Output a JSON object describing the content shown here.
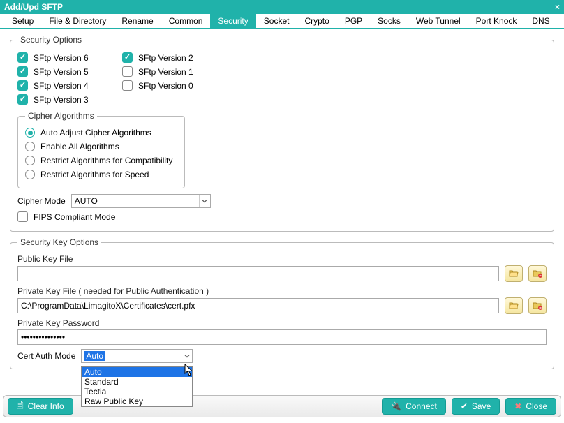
{
  "titlebar": {
    "title": "Add/Upd SFTP",
    "close_glyph": "×"
  },
  "tabs": [
    {
      "label": "Setup"
    },
    {
      "label": "File & Directory"
    },
    {
      "label": "Rename"
    },
    {
      "label": "Common"
    },
    {
      "label": "Security",
      "active": true
    },
    {
      "label": "Socket"
    },
    {
      "label": "Crypto"
    },
    {
      "label": "PGP"
    },
    {
      "label": "Socks"
    },
    {
      "label": "Web Tunnel"
    },
    {
      "label": "Port Knock"
    },
    {
      "label": "DNS"
    }
  ],
  "security_options": {
    "legend": "Security Options",
    "versions_left": [
      {
        "label": "SFtp Version 6",
        "checked": true
      },
      {
        "label": "SFtp Version 5",
        "checked": true
      },
      {
        "label": "SFtp Version 4",
        "checked": true
      },
      {
        "label": "SFtp Version 3",
        "checked": true
      }
    ],
    "versions_right": [
      {
        "label": "SFtp Version 2",
        "checked": true
      },
      {
        "label": "SFtp Version 1",
        "checked": false
      },
      {
        "label": "SFtp Version 0",
        "checked": false
      }
    ],
    "cipher_legend": "Cipher Algorithms",
    "cipher_radios": [
      {
        "label": "Auto Adjust Cipher Algorithms",
        "selected": true
      },
      {
        "label": "Enable All Algorithms",
        "selected": false
      },
      {
        "label": "Restrict Algorithms for Compatibility",
        "selected": false
      },
      {
        "label": "Restrict Algorithms for Speed",
        "selected": false
      }
    ],
    "cipher_mode_label": "Cipher Mode",
    "cipher_mode_value": "AUTO",
    "fips_label": "FIPS Compliant Mode",
    "fips_checked": false
  },
  "key_options": {
    "legend": "Security Key Options",
    "public_key_label": "Public Key File",
    "public_key_value": "",
    "private_key_label": "Private Key File ( needed for Public Authentication )",
    "private_key_value": "C:\\ProgramData\\LimagitoX\\Certificates\\cert.pfx",
    "private_pwd_label": "Private Key Password",
    "private_pwd_value": "•••••••••••••••",
    "cert_label": "Cert Auth Mode",
    "cert_value": "Auto",
    "cert_options": [
      "Auto",
      "Standard",
      "Tectia",
      "Raw Public Key"
    ]
  },
  "footer": {
    "clear": "Clear Info",
    "connect": "Connect",
    "save": "Save",
    "close": "Close"
  },
  "icons": {
    "browse": "folder-open-icon",
    "remove": "folder-delete-icon"
  }
}
